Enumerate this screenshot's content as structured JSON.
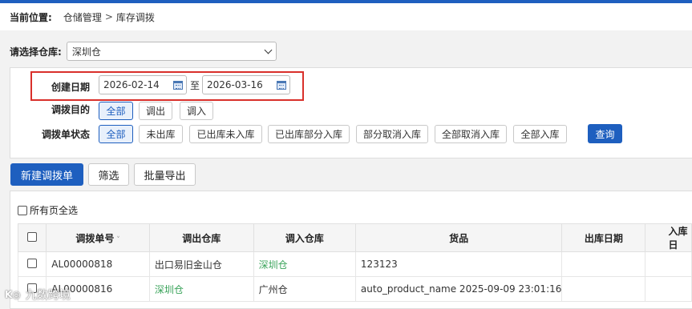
{
  "breadcrumb": {
    "label": "当前位置:",
    "items": [
      "仓储管理",
      "库存调拨"
    ],
    "separator": ">"
  },
  "warehouse": {
    "label": "请选择仓库:",
    "selected": "深圳仓"
  },
  "filters": {
    "created_date": {
      "label": "创建日期",
      "from": "2026-02-14",
      "to_word": "至",
      "to": "2026-03-16"
    },
    "purpose": {
      "label": "调拨目的",
      "options": [
        "全部",
        "调出",
        "调入"
      ],
      "active": "全部"
    },
    "status": {
      "label": "调拨单状态",
      "options": [
        "全部",
        "未出库",
        "已出库未入库",
        "已出库部分入库",
        "部分取消入库",
        "全部取消入库",
        "全部入库"
      ],
      "active": "全部"
    },
    "query_label": "查询"
  },
  "actions": {
    "new_label": "新建调拨单",
    "filter_label": "筛选",
    "export_label": "批量导出"
  },
  "select_all_pages": "所有页全选",
  "table": {
    "columns": [
      "调拨单号",
      "调出仓库",
      "调入仓库",
      "货品",
      "出库日期",
      "入库日"
    ],
    "rows": [
      {
        "id": "AL00000818",
        "from": "出口易旧金山仓",
        "to": "深圳仓",
        "goods": "123123",
        "out_date": "",
        "in_date": ""
      },
      {
        "id": "AL00000816",
        "from": "深圳仓",
        "to": "广州仓",
        "goods": "auto_product_name 2025-09-09 23:01:16",
        "out_date": "",
        "in_date": ""
      }
    ]
  },
  "colors": {
    "brand": "#1e5fbf",
    "highlight": "#d9302b",
    "link_green": "#3aa35a"
  },
  "watermark": "九数跨境"
}
